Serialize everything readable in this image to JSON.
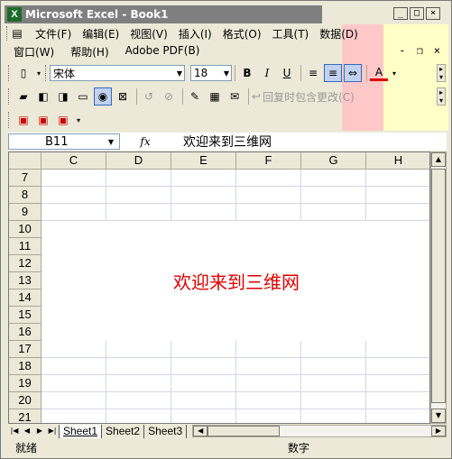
{
  "window": {
    "title": "Microsoft Excel - Book1",
    "app_icon": "X"
  },
  "window_buttons": {
    "minimize": "_",
    "restore": "□",
    "close": "×"
  },
  "menu": [
    "文件(F)",
    "编辑(E)",
    "视图(V)",
    "插入(I)",
    "格式(O)",
    "工具(T)",
    "数据(D)"
  ],
  "menu2": [
    "窗口(W)",
    "帮助(H)",
    "Adobe PDF(B)"
  ],
  "mdi": {
    "minimize": "-",
    "restore": "❐",
    "close": "×"
  },
  "format_toolbar": {
    "font": "宋体",
    "size": "18",
    "bold": "B",
    "italic": "I",
    "underline": "U",
    "font_color": "A"
  },
  "review_toolbar": {
    "reply_label": "回复时包含更改(C)"
  },
  "formula_bar": {
    "name_box": "B11",
    "fx": "fx",
    "value": "欢迎来到三维网"
  },
  "columns": [
    "C",
    "D",
    "E",
    "F",
    "G",
    "H"
  ],
  "rows": [
    "7",
    "8",
    "9",
    "10",
    "11",
    "12",
    "13",
    "14",
    "15",
    "16",
    "17",
    "18",
    "19",
    "20",
    "21"
  ],
  "merged_cell": {
    "text": "欢迎来到三维网",
    "color": "#e00000"
  },
  "sheets": [
    "Sheet1",
    "Sheet2",
    "Sheet3"
  ],
  "status": {
    "left": "就绪",
    "mode": "数字"
  }
}
